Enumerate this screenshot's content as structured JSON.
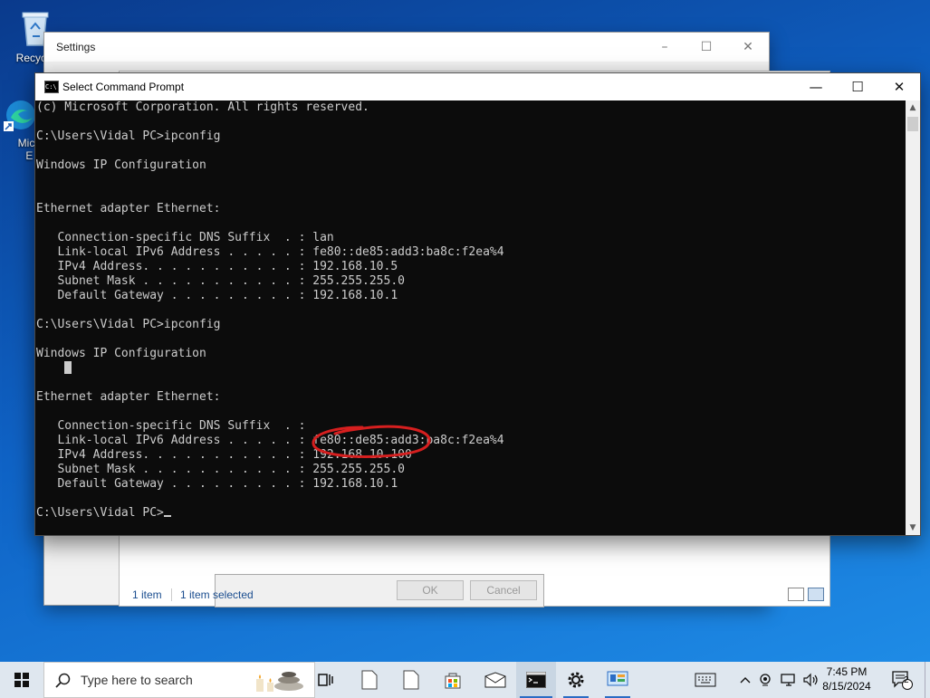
{
  "desktop": {
    "icons": [
      {
        "label": "Recycle",
        "icon": "recycle-bin-icon"
      },
      {
        "label": "Mic\nE",
        "icon": "edge-shortcut-icon"
      }
    ]
  },
  "settings_window": {
    "title": "Settings",
    "controls": {
      "minimize": "–",
      "maximize": "☐",
      "close": "✕"
    }
  },
  "explorer": {
    "status_items": "1 item",
    "status_selected": "1 item selected"
  },
  "dialog": {
    "ok_label": "OK",
    "cancel_label": "Cancel"
  },
  "cmd_window": {
    "title": "Select Command Prompt",
    "controls": {
      "minimize": "—",
      "maximize": "☐",
      "close": "✕"
    }
  },
  "console": {
    "lines": [
      "(c) Microsoft Corporation. All rights reserved.",
      "",
      "C:\\Users\\Vidal PC>ipconfig",
      "",
      "Windows IP Configuration",
      "",
      "",
      "Ethernet adapter Ethernet:",
      "",
      "   Connection-specific DNS Suffix  . : lan",
      "   Link-local IPv6 Address . . . . . : fe80::de85:add3:ba8c:f2ea%4",
      "   IPv4 Address. . . . . . . . . . . : 192.168.10.5",
      "   Subnet Mask . . . . . . . . . . . : 255.255.255.0",
      "   Default Gateway . . . . . . . . . : 192.168.10.1",
      "",
      "C:\\Users\\Vidal PC>ipconfig",
      "",
      "Windows IP Configuration",
      "",
      "",
      "Ethernet adapter Ethernet:",
      "",
      "   Connection-specific DNS Suffix  . :",
      "   Link-local IPv6 Address . . . . . : fe80::de85:add3:ba8c:f2ea%4",
      "   IPv4 Address. . . . . . . . . . . : 192.168.10.100",
      "   Subnet Mask . . . . . . . . . . . : 255.255.255.0",
      "   Default Gateway . . . . . . . . . : 192.168.10.1",
      "",
      "C:\\Users\\Vidal PC>"
    ],
    "highlight_color": "#d61f1f"
  },
  "taskbar": {
    "search_placeholder": "Type here to search",
    "time": "7:45 PM",
    "date": "8/15/2024",
    "notification_count": "2",
    "pinned": [
      "task-view-icon",
      "file-icon",
      "file-icon",
      "store-icon",
      "mail-icon",
      "command-prompt-icon",
      "settings-icon",
      "control-panel-icon"
    ]
  }
}
